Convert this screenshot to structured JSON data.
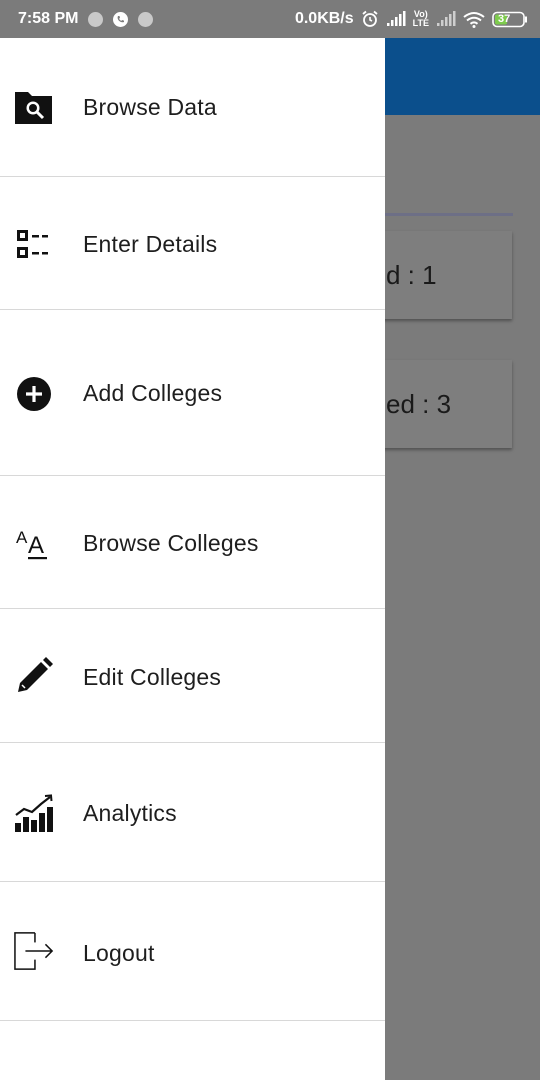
{
  "status_bar": {
    "time": "7:58 PM",
    "network_speed": "0.0KB/s",
    "volte_top": "Vo)",
    "volte_bottom": "LTE",
    "battery": "37"
  },
  "background": {
    "card_one_text": "d : 1",
    "card_two_text": "ed : 3",
    "app_bar_color": "#0b4f8c"
  },
  "drawer": {
    "items": [
      {
        "label": "Browse Data",
        "icon": "folder-search-icon"
      },
      {
        "label": "Enter Details",
        "icon": "form-list-icon"
      },
      {
        "label": "Add Colleges",
        "icon": "add-circle-icon"
      },
      {
        "label": "Browse Colleges",
        "icon": "text-format-icon"
      },
      {
        "label": "Edit Colleges",
        "icon": "pencil-icon"
      },
      {
        "label": "Analytics",
        "icon": "analytics-chart-icon"
      },
      {
        "label": "Logout",
        "icon": "logout-icon"
      }
    ]
  }
}
